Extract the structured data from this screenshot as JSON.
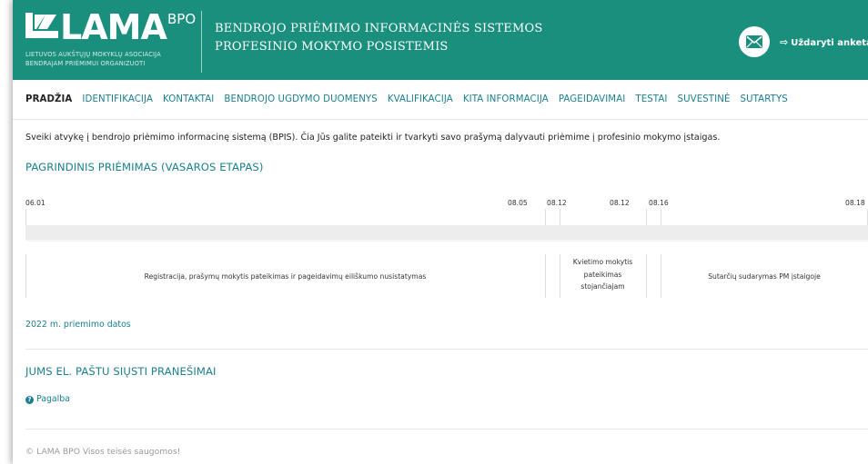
{
  "header": {
    "logo_text": "LAMA",
    "logo_sup": "BPO",
    "logo_sub_line1": "Lietuvos aukštųjų mokyklų asociacija",
    "logo_sub_line2": "bendrajam priėmimui organizuoti",
    "title_line1": "BENDROJO PRIĖMIMO INFORMACINĖS SISTEMOS",
    "title_line2": "PROFESINIO MOKYMO POSISTEMIS",
    "close_form_label": "Uždaryti anketą"
  },
  "nav": {
    "items": [
      "PRADŽIA",
      "IDENTIFIKACIJA",
      "KONTAKTAI",
      "BENDROJO UGDYMO DUOMENYS",
      "KVALIFIKACIJA",
      "KITA INFORMACIJA",
      "PAGEIDAVIMAI",
      "TESTAI",
      "SUVESTINĖ",
      "SUTARTYS"
    ]
  },
  "main": {
    "welcome": "Sveiki atvykę į bendrojo priėmimo informacinę sistemą (BPIS). Čia Jūs galite pateikti ir tvarkyti savo prašymą dalyvauti priėmime į profesinio mokymo įstaigas.",
    "section1_title": "PAGRINDINIS PRIĖMIMAS (VASAROS ETAPAS)",
    "timeline": {
      "dates": [
        "06.01",
        "08.05",
        "08.12",
        "08.12",
        "08.16",
        "08.18"
      ],
      "phase1": "Registracija, prašymų mokytis pateikimas ir pageidavimų eiliškumo nusistatymas",
      "phase2_line1": "Kvietimo mokytis",
      "phase2_line2": "pateikimas",
      "phase2_line3": "stojančiajam",
      "phase3": "Sutarčių sudarymas PM įstaigoje"
    },
    "dates_link": "2022 m. priemimo datos",
    "section2_title": "JUMS EL. PAŠTU SIŲSTI PRANEŠIMAI",
    "help_link": "Pagalba"
  },
  "footer": {
    "text": "© LAMA BPO Visos teisės saugomos!"
  },
  "colors": {
    "header_bg": "#1b8f7d",
    "accent": "#1b7f8f"
  }
}
